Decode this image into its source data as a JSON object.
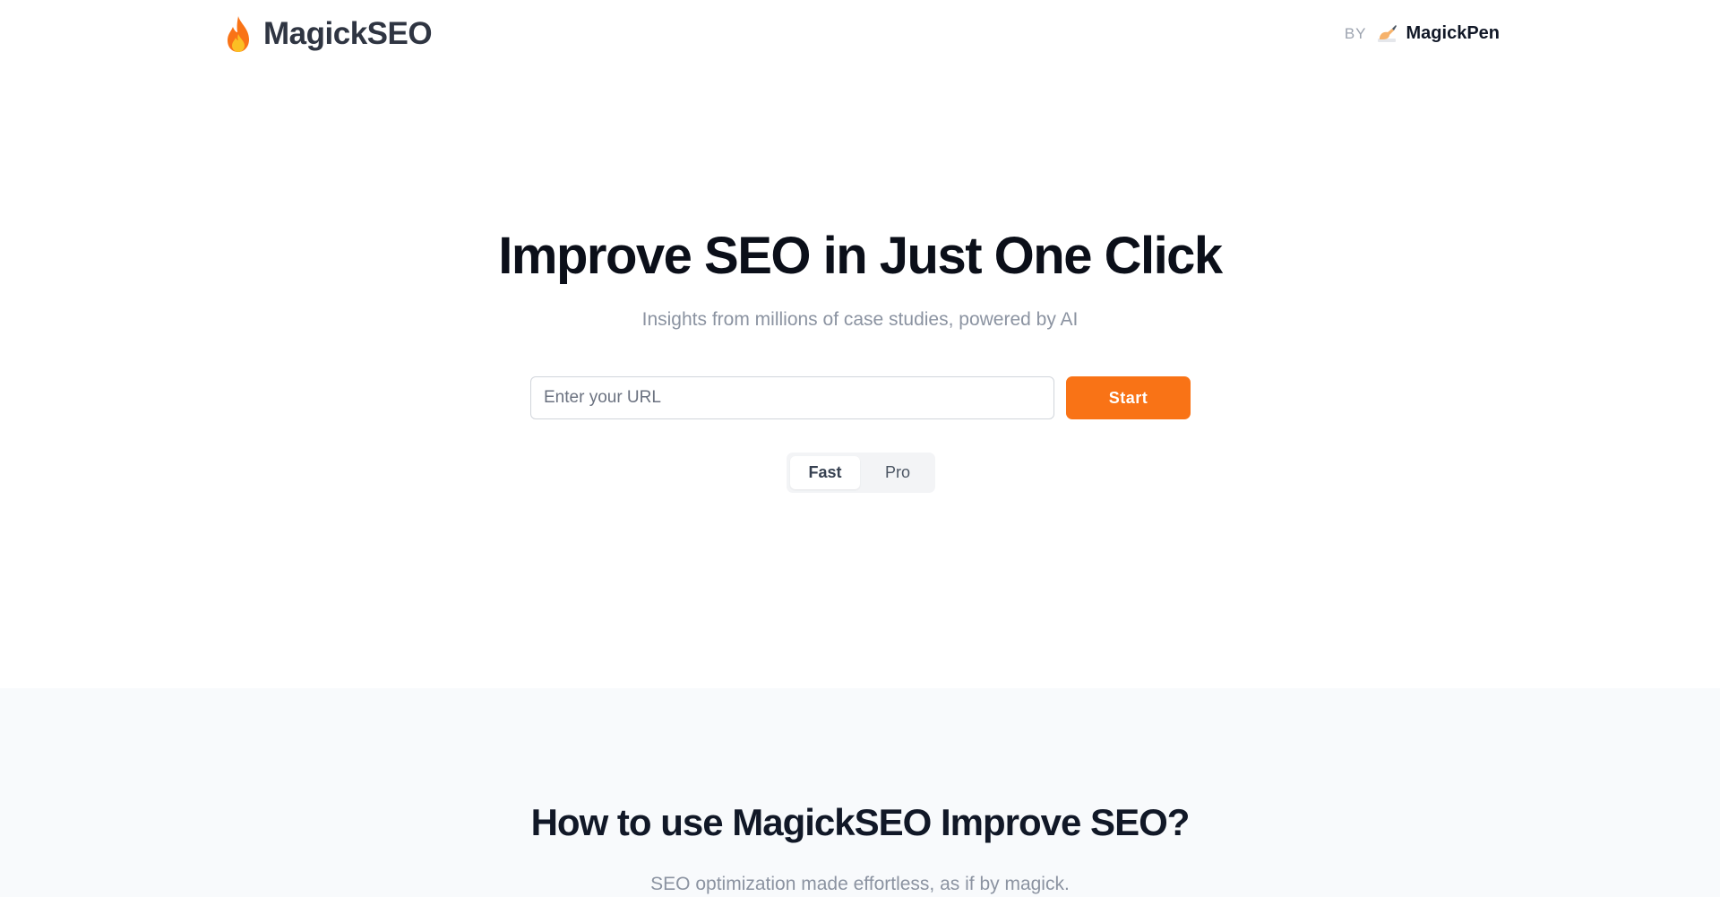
{
  "header": {
    "brand_name": "MagickSEO",
    "brand_icon": "flame-icon",
    "by_label": "BY",
    "by_icon": "writing-hand-icon",
    "by_name": "MagickPen"
  },
  "hero": {
    "title": "Improve SEO in Just One Click",
    "subtitle": "Insights from millions of case studies, powered by AI",
    "url_placeholder": "Enter your URL",
    "url_value": "",
    "start_label": "Start",
    "modes": [
      "Fast",
      "Pro"
    ],
    "selected_mode": "Fast"
  },
  "how": {
    "title": "How to use MagickSEO Improve SEO?",
    "subtitle": "SEO optimization made effortless, as if by magick."
  },
  "colors": {
    "accent": "#f97316",
    "heading": "#0b0f19",
    "muted": "#8b93a1",
    "section_bg": "#f8fafc"
  }
}
